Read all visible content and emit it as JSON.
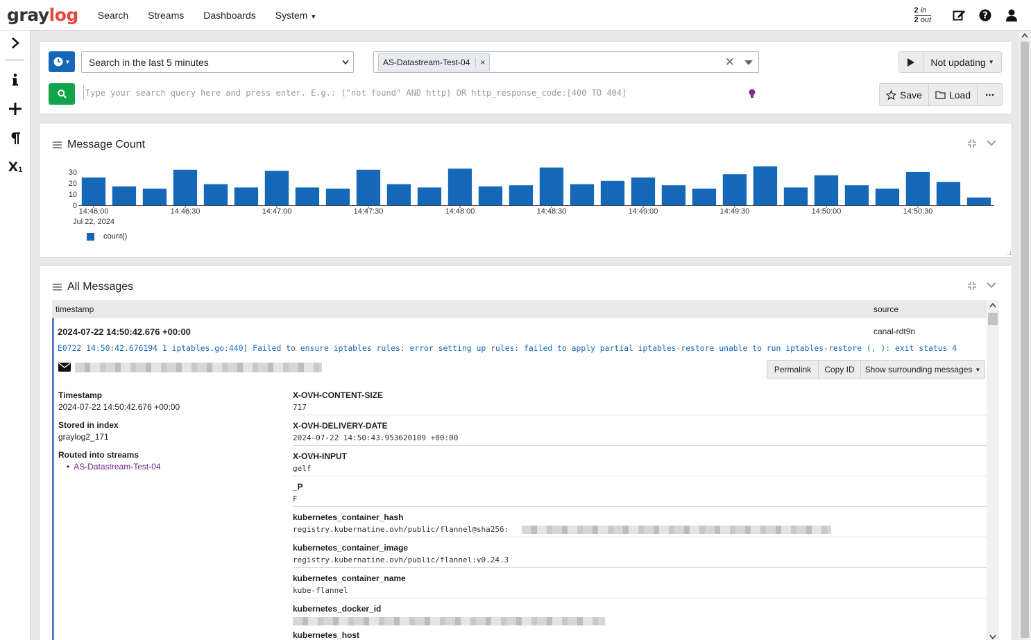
{
  "brand": {
    "part1": "gray",
    "part2": "log"
  },
  "nav": {
    "search": "Search",
    "streams": "Streams",
    "dashboards": "Dashboards",
    "system": "System"
  },
  "throughput": {
    "in_count": "2",
    "in_label": "in",
    "out_count": "2",
    "out_label": "out"
  },
  "sidebar": {
    "x_sub": "1"
  },
  "search": {
    "timerange": "Search in the last 5 minutes",
    "stream_chip": "AS-Datastream-Test-04",
    "query_placeholder": "Type your search query here and press enter. E.g.: (\"not found\" AND http) OR http_response_code:[400 TO 404]",
    "refresh_label": "Not updating",
    "save_label": "Save",
    "load_label": "Load"
  },
  "message_count": {
    "title": "Message Count",
    "legend_label": "count()"
  },
  "chart_data": {
    "type": "bar",
    "title": "Message Count",
    "xlabel": "",
    "ylabel": "",
    "ylim": [
      0,
      35
    ],
    "yticks": [
      0,
      10,
      20,
      30
    ],
    "xtick_labels": [
      "14:46:00",
      "14:46:30",
      "14:47:00",
      "14:47:30",
      "14:48:00",
      "14:48:30",
      "14:49:00",
      "14:49:30",
      "14:50:00",
      "14:50:30"
    ],
    "xtick_sublabel": "Jul 22, 2024",
    "series": [
      {
        "name": "count()",
        "color": "#1568b8",
        "values": [
          25,
          17,
          15,
          32,
          19,
          16,
          31,
          16,
          15,
          32,
          19,
          16,
          33,
          17,
          18,
          34,
          19,
          22,
          25,
          18,
          15,
          28,
          35,
          16,
          27,
          18,
          15,
          30,
          21,
          7
        ]
      }
    ]
  },
  "all_messages": {
    "title": "All Messages",
    "col_timestamp": "timestamp",
    "col_source": "source",
    "message": {
      "timestamp": "2024-07-22 14:50:42.676 +00:00",
      "source": "canal-rdt9n",
      "text": "E0722 14:50:42.676194 1 iptables.go:440] Failed to ensure iptables rules: error setting up rules: failed to apply partial iptables-restore unable to run iptables-restore (, ): exit status 4",
      "actions": {
        "permalink": "Permalink",
        "copy_id": "Copy ID",
        "surrounding": "Show surrounding messages"
      },
      "meta": {
        "timestamp_label": "Timestamp",
        "timestamp_value": "2024-07-22 14:50:42.676 +00:00",
        "index_label": "Stored in index",
        "index_value": "graylog2_171",
        "streams_label": "Routed into streams",
        "stream_value": "AS-Datastream-Test-04"
      },
      "fields": [
        {
          "name": "X-OVH-CONTENT-SIZE",
          "value": "717"
        },
        {
          "name": "X-OVH-DELIVERY-DATE",
          "value": "2024-07-22 14:50:43.953620109 +00:00"
        },
        {
          "name": "X-OVH-INPUT",
          "value": "gelf"
        },
        {
          "name": "_P",
          "value": "F"
        },
        {
          "name": "kubernetes_container_hash",
          "value": "registry.kubernatine.ovh/public/flannel@sha256:"
        },
        {
          "name": "kubernetes_container_image",
          "value": "registry.kubernatine.ovh/public/flannel:v0.24.3"
        },
        {
          "name": "kubernetes_container_name",
          "value": "kube-flannel"
        },
        {
          "name": "kubernetes_docker_id",
          "value": ""
        },
        {
          "name": "kubernetes_host",
          "value": ""
        }
      ]
    }
  }
}
